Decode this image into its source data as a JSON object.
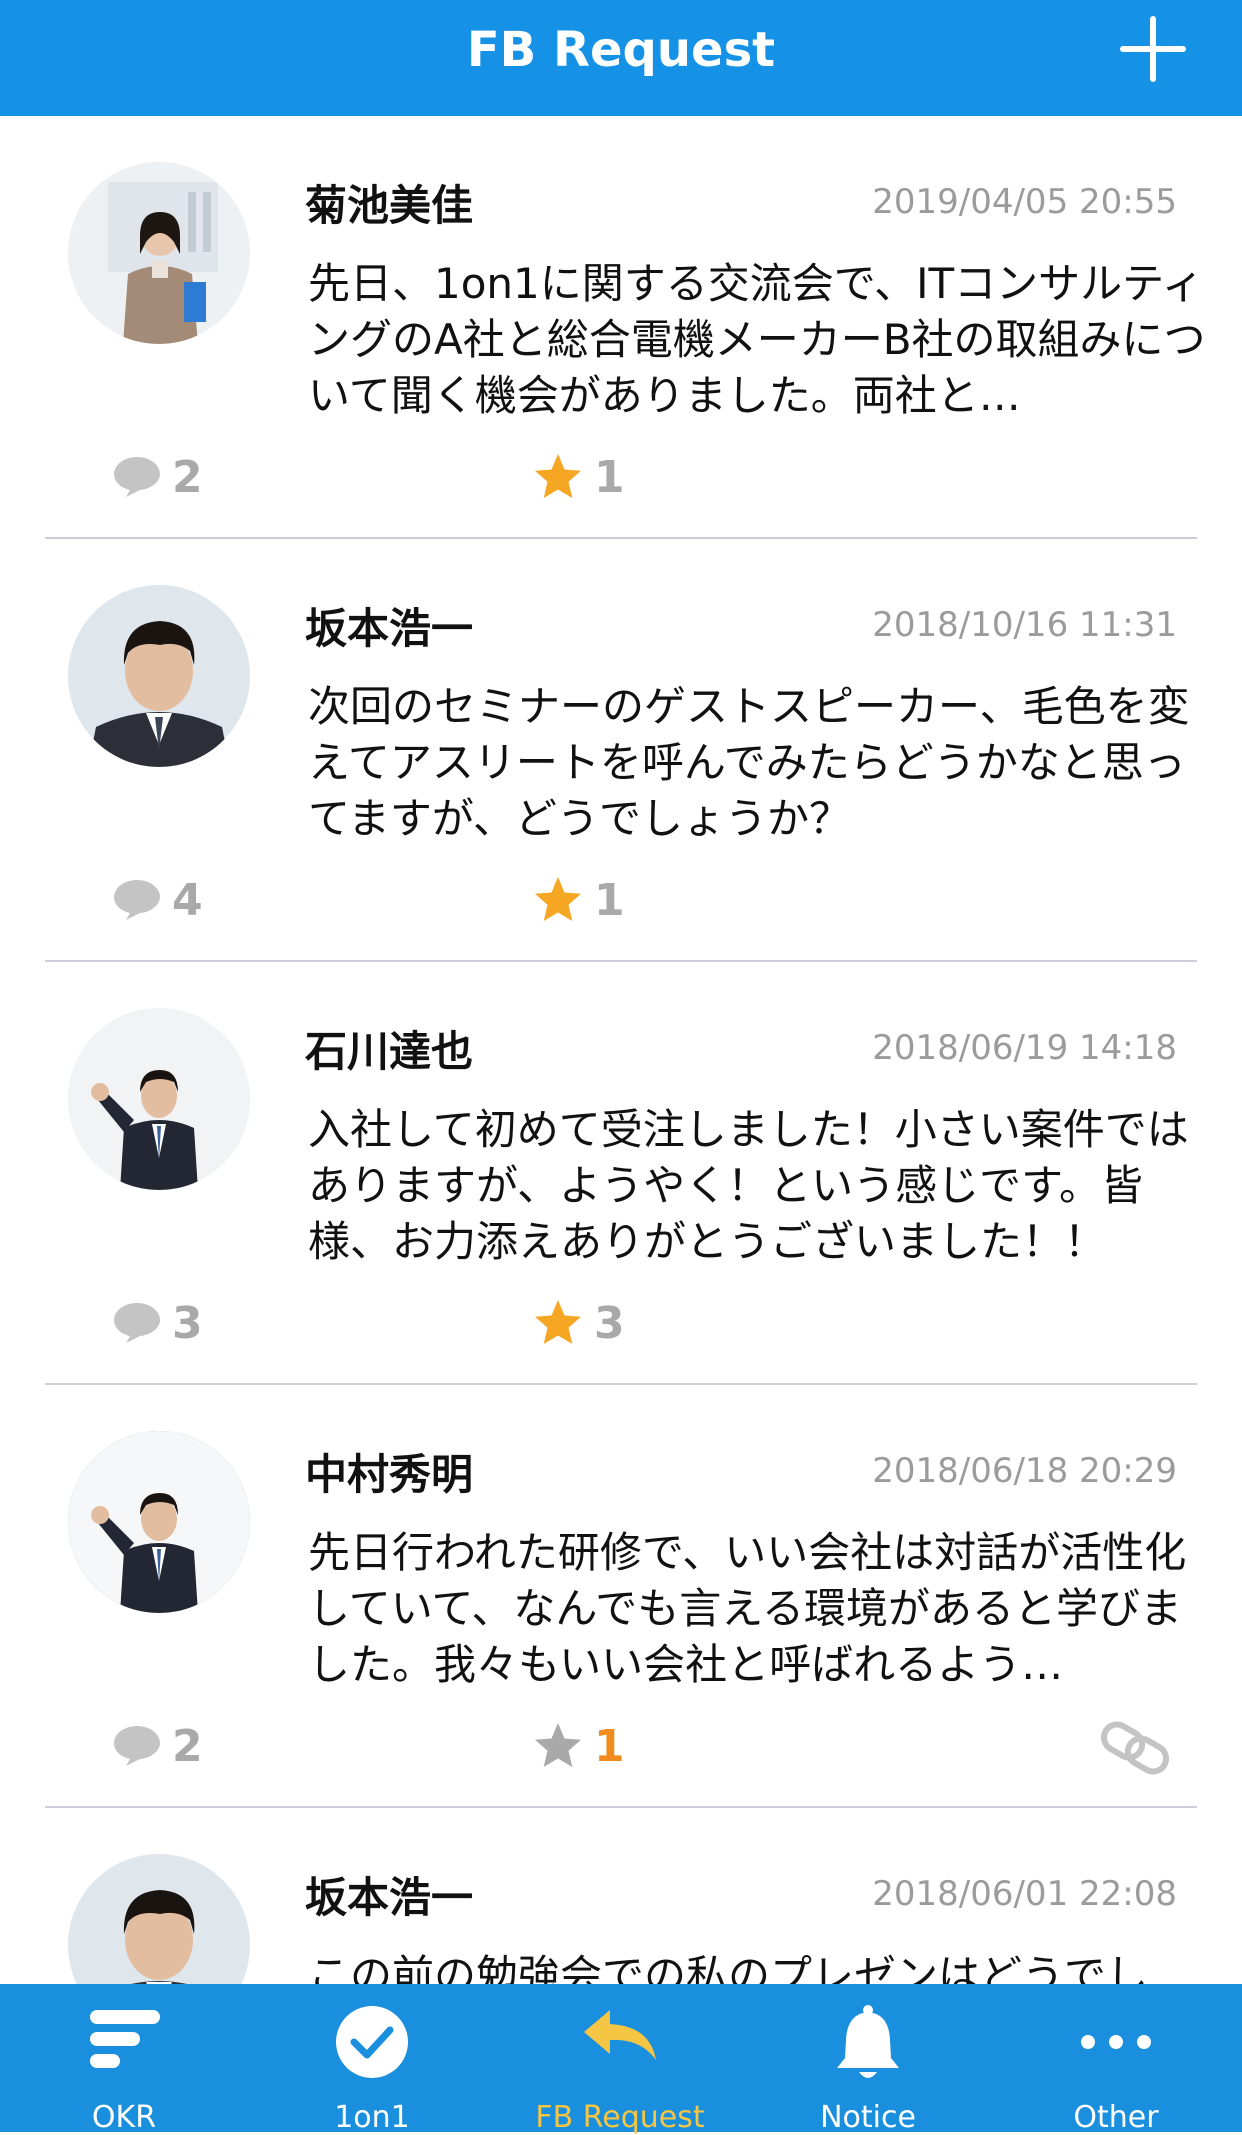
{
  "header": {
    "title": "FB Request",
    "add_label": "+"
  },
  "posts": [
    {
      "author": "菊池美佳",
      "timestamp": "2019/04/05 20:55",
      "body": "先日、1on1に関する交流会で、ITコンサルティングのA社と総合電機メーカーB社の取組みについて聞く機会がありました。両社と…",
      "comments": "2",
      "stars": "1",
      "star_active": true
    },
    {
      "author": "坂本浩一",
      "timestamp": "2018/10/16 11:31",
      "body": "次回のセミナーのゲストスピーカー、毛色を変えてアスリートを呼んでみたらどうかなと思ってますが、どうでしょうか？",
      "comments": "4",
      "stars": "1",
      "star_active": true
    },
    {
      "author": "石川達也",
      "timestamp": "2018/06/19 14:18",
      "body": "入社して初めて受注しました！小さい案件ではありますが、ようやく！という感じです。皆様、お力添えありがとうございました！！",
      "comments": "3",
      "stars": "3",
      "star_active": true
    },
    {
      "author": "中村秀明",
      "timestamp": "2018/06/18 20:29",
      "body": "先日行われた研修で、いい会社は対話が活性化していて、なんでも言える環境があると学びました。我々もいい会社と呼ばれるよう…",
      "comments": "2",
      "stars": "1",
      "star_active": false
    },
    {
      "author": "坂本浩一",
      "timestamp": "2018/06/01 22:08",
      "body": "この前の勉強会での私のプレゼンはどうでし"
    }
  ],
  "tabs": [
    {
      "label": "OKR",
      "icon": "okr-icon"
    },
    {
      "label": "1on1",
      "icon": "check-circle-icon"
    },
    {
      "label": "FB Request",
      "icon": "reply-arrow-icon",
      "active": true
    },
    {
      "label": "Notice",
      "icon": "bell-icon"
    },
    {
      "label": "Other",
      "icon": "more-dots-icon"
    }
  ],
  "colors": {
    "header_bg": "#1592e6",
    "tabbar_bg": "#1a8fdd",
    "active_tab": "#f5c544",
    "star": "#f5a623",
    "star_inactive": "#a9a9a9",
    "count_highlight": "#f08c1e"
  }
}
